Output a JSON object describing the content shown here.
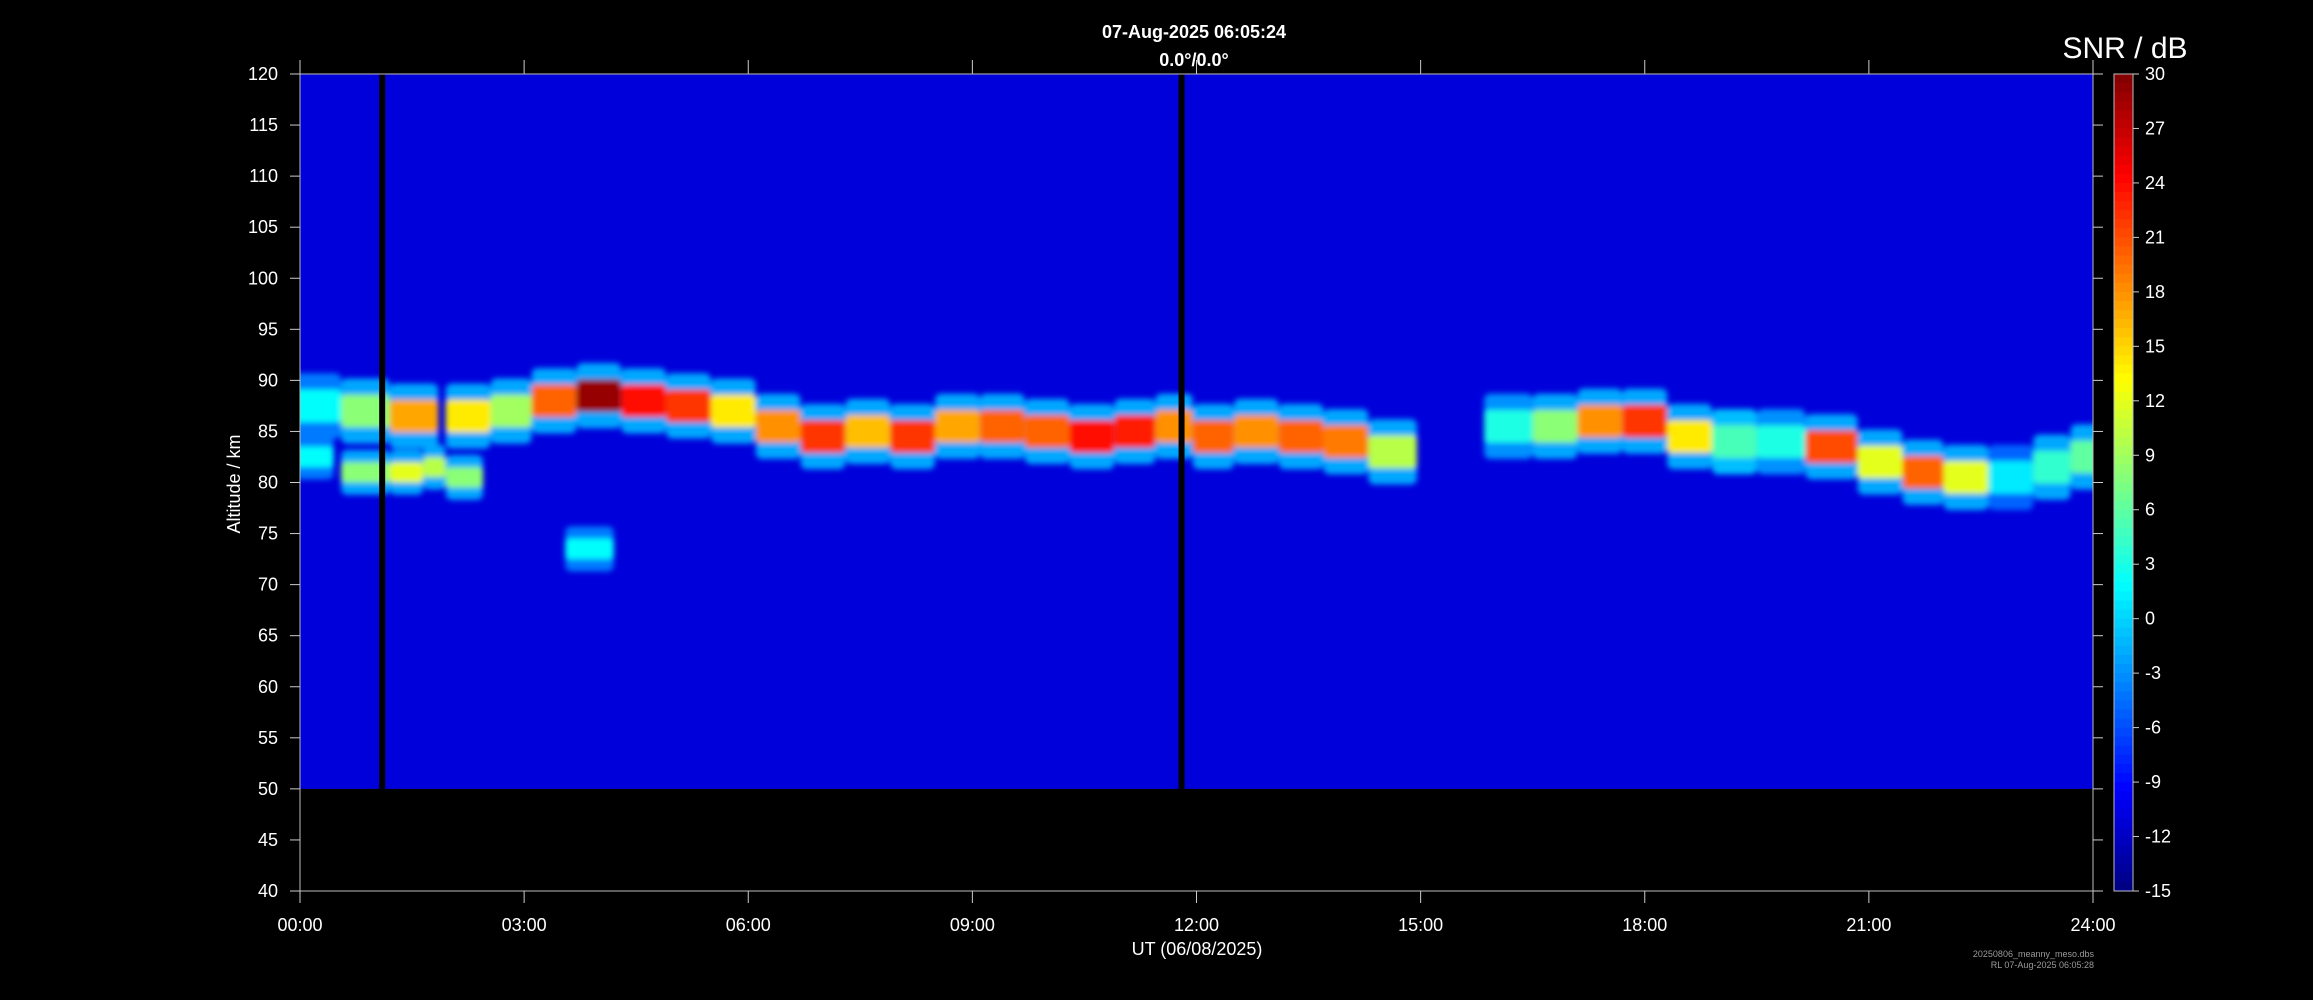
{
  "chart_data": {
    "type": "heatmap",
    "title": "07-Aug-2025 06:05:24",
    "subtitle": "0.0°/0.0°",
    "xlabel": "UT (06/08/2025)",
    "ylabel": "Altitude / km",
    "colorbar_label": "SNR / dB",
    "x_ticks": [
      "00:00",
      "03:00",
      "06:00",
      "09:00",
      "12:00",
      "15:00",
      "18:00",
      "21:00",
      "24:00"
    ],
    "xlim_hours": [
      0,
      24
    ],
    "ylim_km": [
      40,
      120
    ],
    "y_ticks": [
      40,
      45,
      50,
      55,
      60,
      65,
      70,
      75,
      80,
      85,
      90,
      95,
      100,
      105,
      110,
      115,
      120
    ],
    "data_altitude_range_km": [
      50,
      120
    ],
    "colorbar_range_db": [
      -15,
      30
    ],
    "colorbar_ticks": [
      -15,
      -12,
      -9,
      -6,
      -3,
      0,
      3,
      6,
      9,
      12,
      15,
      18,
      21,
      24,
      27,
      30
    ],
    "colormap": "jet",
    "background_snr_db": -11,
    "data_gaps_hours": [
      1.1,
      11.8
    ],
    "echo_layer": [
      {
        "x": 0.2,
        "y": 87.5,
        "snr": 2
      },
      {
        "x": 0.9,
        "y": 87.0,
        "snr": 8
      },
      {
        "x": 1.5,
        "y": 86.5,
        "snr": 17
      },
      {
        "x": 2.3,
        "y": 86.5,
        "snr": 14
      },
      {
        "x": 2.8,
        "y": 87.0,
        "snr": 9
      },
      {
        "x": 3.4,
        "y": 88.0,
        "snr": 20
      },
      {
        "x": 4.0,
        "y": 88.5,
        "snr": 29
      },
      {
        "x": 4.6,
        "y": 88.0,
        "snr": 24
      },
      {
        "x": 5.2,
        "y": 87.5,
        "snr": 22
      },
      {
        "x": 5.8,
        "y": 87.0,
        "snr": 14
      },
      {
        "x": 6.4,
        "y": 85.5,
        "snr": 18
      },
      {
        "x": 7.0,
        "y": 84.5,
        "snr": 22
      },
      {
        "x": 7.6,
        "y": 85.0,
        "snr": 16
      },
      {
        "x": 8.2,
        "y": 84.5,
        "snr": 22
      },
      {
        "x": 8.8,
        "y": 85.5,
        "snr": 17
      },
      {
        "x": 9.4,
        "y": 85.5,
        "snr": 20
      },
      {
        "x": 10.0,
        "y": 85.0,
        "snr": 20
      },
      {
        "x": 10.6,
        "y": 84.5,
        "snr": 24
      },
      {
        "x": 11.2,
        "y": 85.0,
        "snr": 23
      },
      {
        "x": 11.7,
        "y": 85.5,
        "snr": 18
      },
      {
        "x": 12.2,
        "y": 84.5,
        "snr": 20
      },
      {
        "x": 12.8,
        "y": 85.0,
        "snr": 18
      },
      {
        "x": 13.4,
        "y": 84.5,
        "snr": 20
      },
      {
        "x": 14.0,
        "y": 84.0,
        "snr": 19
      },
      {
        "x": 14.6,
        "y": 83.0,
        "snr": 10
      },
      {
        "x": 16.2,
        "y": 85.5,
        "snr": 3
      },
      {
        "x": 16.8,
        "y": 85.5,
        "snr": 8
      },
      {
        "x": 17.4,
        "y": 86.0,
        "snr": 18
      },
      {
        "x": 18.0,
        "y": 86.0,
        "snr": 22
      },
      {
        "x": 18.6,
        "y": 84.5,
        "snr": 14
      },
      {
        "x": 19.2,
        "y": 84.0,
        "snr": 5
      },
      {
        "x": 19.8,
        "y": 84.0,
        "snr": 3
      },
      {
        "x": 20.5,
        "y": 83.5,
        "snr": 21
      },
      {
        "x": 21.2,
        "y": 82.0,
        "snr": 12
      },
      {
        "x": 21.7,
        "y": 81.0,
        "snr": 20
      },
      {
        "x": 22.3,
        "y": 80.5,
        "snr": 12
      },
      {
        "x": 22.9,
        "y": 80.5,
        "snr": 1
      },
      {
        "x": 23.5,
        "y": 81.5,
        "snr": 4
      },
      {
        "x": 23.9,
        "y": 82.5,
        "snr": 6
      }
    ],
    "secondary_echoes": [
      {
        "x": 0.1,
        "y": 82.5,
        "snr": 2
      },
      {
        "x": 0.9,
        "y": 81.0,
        "snr": 8
      },
      {
        "x": 1.5,
        "y": 81.0,
        "snr": 12
      },
      {
        "x": 1.8,
        "y": 81.5,
        "snr": 10
      },
      {
        "x": 2.1,
        "y": 80.5,
        "snr": 8
      },
      {
        "x": 3.9,
        "y": 73.5,
        "snr": 2
      }
    ]
  },
  "footer": {
    "line1": "20250806_meanny_meso.dbs",
    "line2": "RL 07-Aug-2025 06:05:28"
  },
  "colors": {
    "background": "#000000",
    "axis": "#ffffff",
    "gap": "#000000"
  }
}
